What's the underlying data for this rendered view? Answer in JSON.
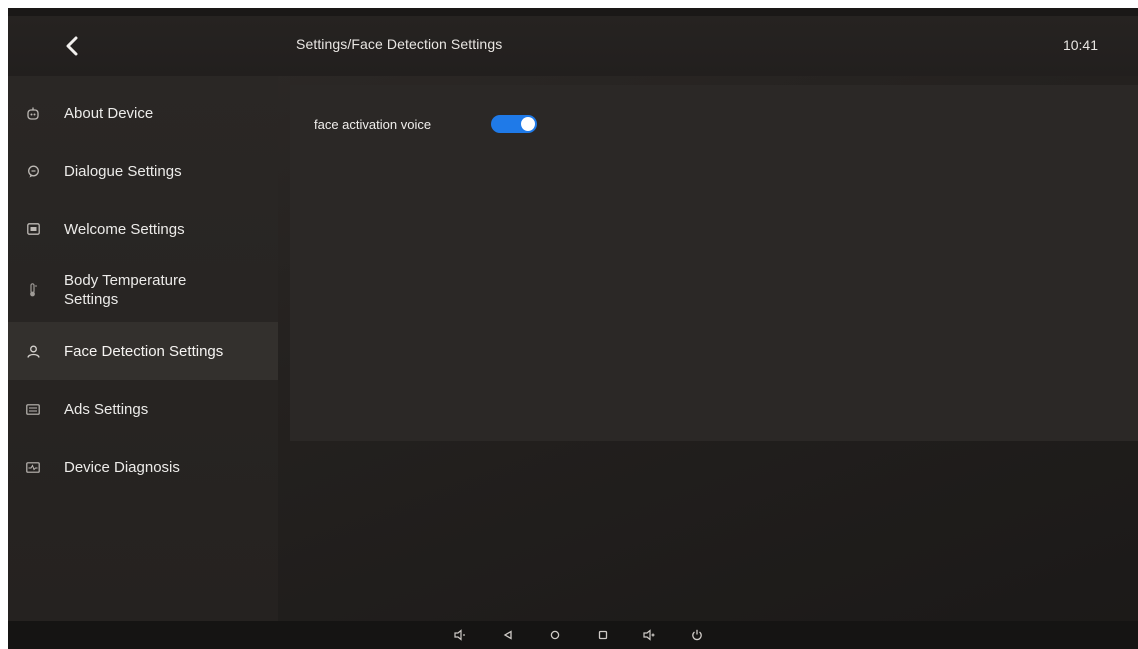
{
  "header": {
    "title": "Settings/Face Detection Settings",
    "time": "10:41",
    "back_icon": "chevron-left-icon"
  },
  "sidebar": {
    "active_index": 4,
    "items": [
      {
        "label": "About Device",
        "icon": "robot-icon"
      },
      {
        "label": "Dialogue Settings",
        "icon": "chat-bubble-icon"
      },
      {
        "label": "Welcome Settings",
        "icon": "image-frame-icon"
      },
      {
        "label": "Body Temperature Settings",
        "icon": "thermometer-icon"
      },
      {
        "label": "Face Detection Settings",
        "icon": "person-icon"
      },
      {
        "label": "Ads Settings",
        "icon": "ad-icon"
      },
      {
        "label": "Device Diagnosis",
        "icon": "diagnosis-icon"
      }
    ]
  },
  "content": {
    "face_activation_voice": {
      "label": "face activation voice",
      "enabled": true
    }
  },
  "navbar": {
    "buttons": [
      "volume-down-icon",
      "back-triangle-icon",
      "home-circle-icon",
      "recents-square-icon",
      "volume-up-icon",
      "power-icon"
    ]
  },
  "colors": {
    "accent": "#1f7ae8",
    "background": "#24211f",
    "text": "#ecebe9"
  }
}
